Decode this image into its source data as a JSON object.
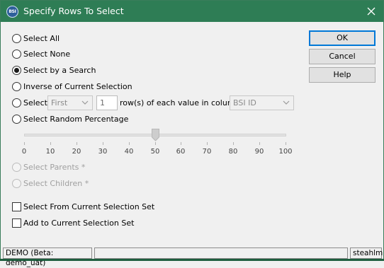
{
  "dialog": {
    "title": "Specify Rows To Select",
    "icon_text": "BSI",
    "title_color": "#2e7d55"
  },
  "options": [
    {
      "label": "Select All",
      "checked": false,
      "disabled": false
    },
    {
      "label": "Select None",
      "checked": false,
      "disabled": false
    },
    {
      "label": "Select by a Search",
      "checked": true,
      "disabled": false
    },
    {
      "label": "Inverse of Current Selection",
      "checked": false,
      "disabled": false
    },
    {
      "label": "Select",
      "checked": false,
      "disabled": false
    },
    {
      "label": "Select Random Percentage",
      "checked": false,
      "disabled": false
    },
    {
      "label": "Select Parents *",
      "checked": false,
      "disabled": true
    },
    {
      "label": "Select Children *",
      "checked": false,
      "disabled": true
    }
  ],
  "select_n": {
    "mode_value": "First",
    "count_value": "1",
    "middle_text": "row(s) of each value in column:",
    "column_value": "BSI ID"
  },
  "slider": {
    "value": 50,
    "min": 0,
    "max": 100,
    "tick_labels": [
      "0",
      "10",
      "20",
      "30",
      "40",
      "50",
      "60",
      "70",
      "80",
      "90",
      "100"
    ]
  },
  "checkboxes": [
    {
      "label": "Select From Current Selection Set",
      "checked": false
    },
    {
      "label": "Add to Current Selection Set",
      "checked": false
    }
  ],
  "buttons": {
    "ok": "OK",
    "cancel": "Cancel",
    "help": "Help"
  },
  "status": {
    "left": "DEMO (Beta: demo_uat)",
    "middle": "",
    "right": "steahlm"
  }
}
